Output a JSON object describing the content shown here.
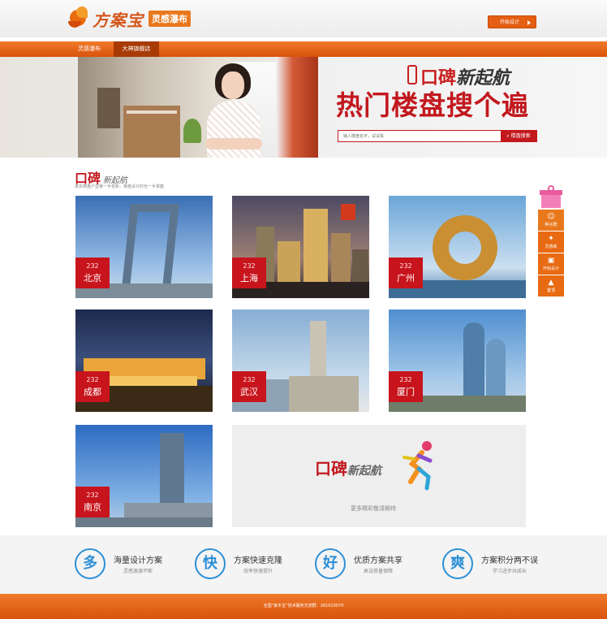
{
  "header": {
    "logo_name": "方案宝",
    "logo_slogan": "灵感瀑布",
    "start_button": "开始设计"
  },
  "nav": [
    {
      "label": "灵感瀑布"
    },
    {
      "label": "大神旗舰店"
    }
  ],
  "banner": {
    "badge": "口碑",
    "line1_red": "口碑",
    "line1_rest": "新起航",
    "line2": "热门楼盘搜个遍",
    "search_placeholder": "输入楼盘名字，试试看",
    "search_button": "楼盘搜索"
  },
  "section": {
    "title_big": "口碑",
    "title_small": "新起航",
    "subtitle": "真实楼盘户型第一手更新，楼盘设计的也一手掌握"
  },
  "cities": [
    {
      "num": "232",
      "name": "北京"
    },
    {
      "num": "232",
      "name": "上海"
    },
    {
      "num": "232",
      "name": "广州"
    },
    {
      "num": "232",
      "name": "成都"
    },
    {
      "num": "232",
      "name": "武汉"
    },
    {
      "num": "232",
      "name": "厦门"
    },
    {
      "num": "232",
      "name": "南京"
    }
  ],
  "more": {
    "title_red": "口碑",
    "title_rest": "新起航",
    "text": "更多精彩敬请期待"
  },
  "float": {
    "items": [
      {
        "label": "种子群",
        "icon": "☺"
      },
      {
        "label": "灵感库",
        "icon": "✦"
      },
      {
        "label": "开始设计",
        "icon": "▣"
      },
      {
        "label": "置顶",
        "icon": "▲"
      }
    ]
  },
  "features": [
    {
      "char": "多",
      "title": "海量设计方案",
      "sub": "灵感源源不断"
    },
    {
      "char": "快",
      "title": "方案快速克隆",
      "sub": "效率快速提升"
    },
    {
      "char": "好",
      "title": "优质方案共享",
      "sub": "高设质量保障"
    },
    {
      "char": "爽",
      "title": "方案积分两不误",
      "sub": "学习进步共成长"
    }
  ],
  "footer": {
    "text": "全国“家乡宝”技术服务交流群：261010070"
  },
  "colors": {
    "brand_orange": "#e86a12",
    "brand_red": "#c2181e",
    "feature_blue": "#2d8fd6"
  }
}
